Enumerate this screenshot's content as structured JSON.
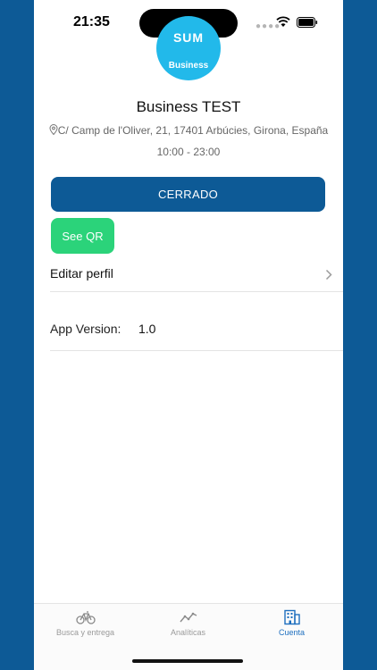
{
  "status_bar": {
    "time": "21:35"
  },
  "logo": {
    "text": "SUM",
    "subtext": "Business"
  },
  "business": {
    "name": "Business TEST",
    "address": "C/ Camp de l'Oliver, 21, 17401 Arbúcies, Girona, España",
    "hours": "10:00 - 23:00"
  },
  "actions": {
    "status_label": "CERRADO",
    "qr_label": "See QR"
  },
  "menu": {
    "edit_profile": "Editar perfil",
    "app_version_label": "App Version:",
    "app_version_value": "1.0"
  },
  "tabs": [
    {
      "label": "Busca y entrega",
      "icon": "bicycle-icon",
      "active": false
    },
    {
      "label": "Analíticas",
      "icon": "chart-line-icon",
      "active": false
    },
    {
      "label": "Cuenta",
      "icon": "building-icon",
      "active": true
    }
  ],
  "colors": {
    "brand_blue": "#0d5a96",
    "logo_cyan": "#22b9ea",
    "qr_green": "#2bd37a",
    "active_tab": "#1e6fbf"
  }
}
